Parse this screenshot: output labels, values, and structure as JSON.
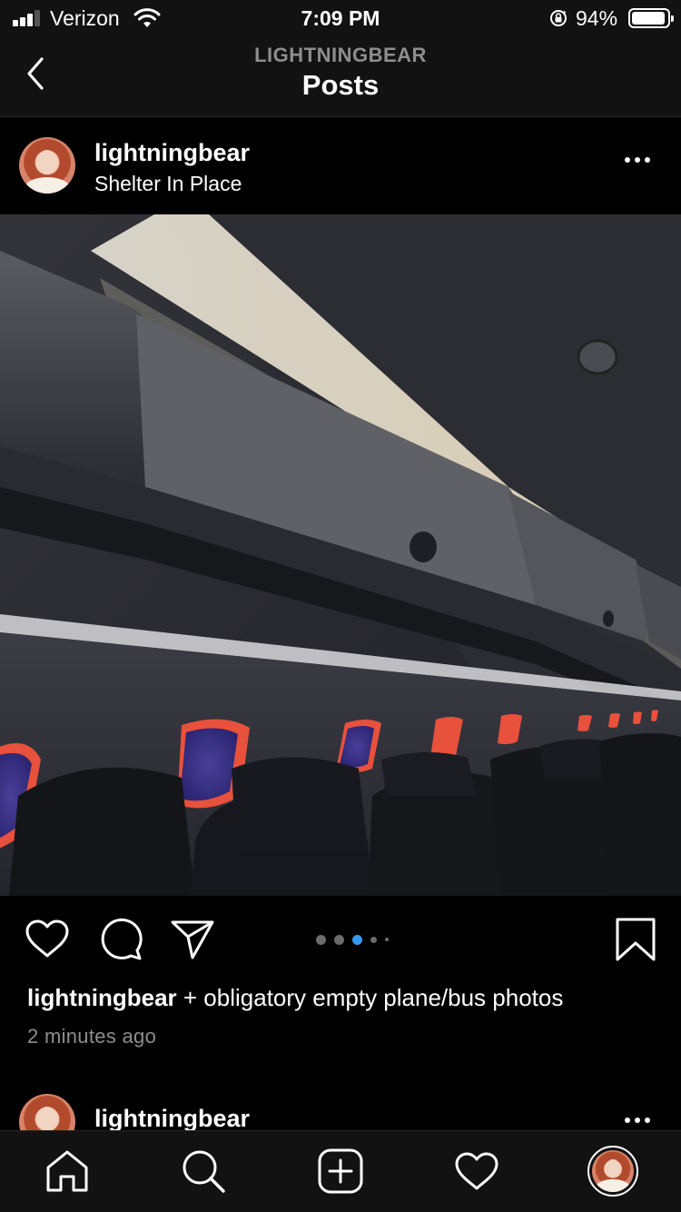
{
  "status_bar": {
    "carrier": "Verizon",
    "time": "7:09 PM",
    "battery_percent": "94%",
    "battery_level": 0.94,
    "signal_bars": 3,
    "icons": [
      "signal-icon",
      "wifi-icon",
      "orientation-lock-icon",
      "battery-icon"
    ]
  },
  "nav": {
    "subtitle": "LIGHTNINGBEAR",
    "title": "Posts",
    "back_icon": "chevron-left-icon"
  },
  "post": {
    "username": "lightningbear",
    "location": "Shelter In Place",
    "more_icon": "more-horizontal-icon",
    "actions": [
      "heart-icon",
      "comment-icon",
      "share-icon",
      "bookmark-icon"
    ],
    "carousel": {
      "count": 5,
      "active_index": 2
    },
    "caption_user": "lightningbear",
    "caption_text": " + obligatory empty plane/bus photos",
    "timestamp": "2 minutes ago"
  },
  "next_post": {
    "username": "lightningbear"
  },
  "tab_bar": {
    "items": [
      "home-icon",
      "search-icon",
      "new-post-icon",
      "activity-icon",
      "profile-avatar"
    ]
  }
}
